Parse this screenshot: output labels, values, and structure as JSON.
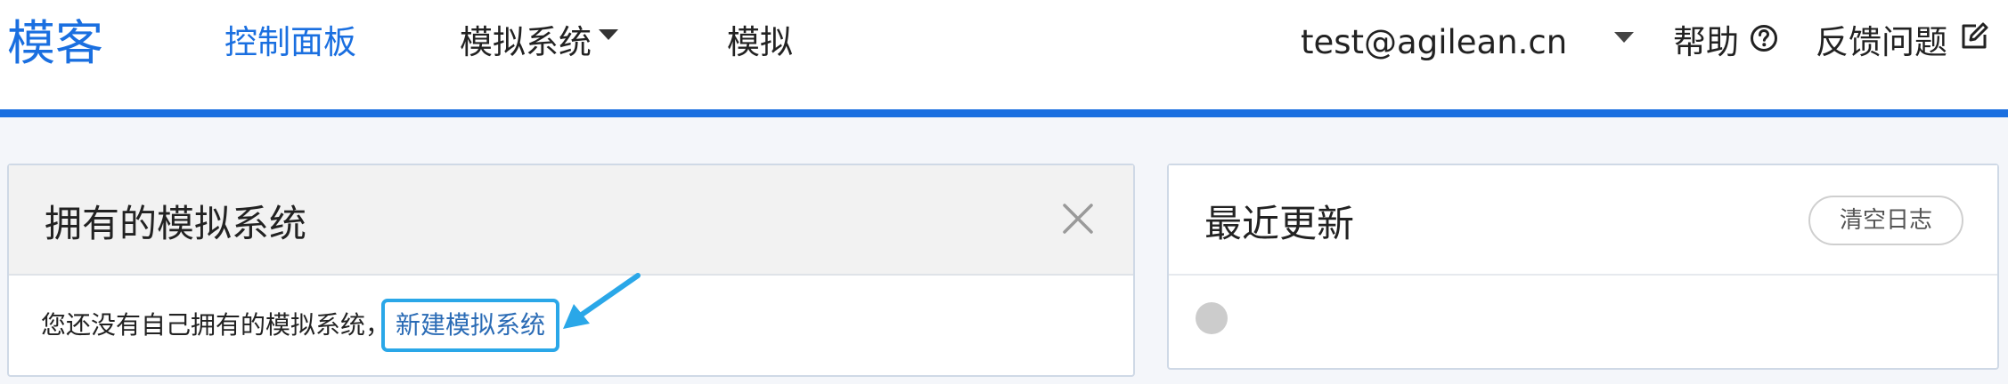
{
  "navbar": {
    "brand": "模客",
    "items": [
      {
        "label": "控制面板",
        "active": true
      },
      {
        "label": "模拟系统",
        "has_dropdown": true
      },
      {
        "label": "模拟"
      }
    ],
    "user_email": "test@agilean.cn",
    "help_label": "帮助",
    "feedback_label": "反馈问题"
  },
  "owned_panel": {
    "title": "拥有的模拟系统",
    "empty_text": "您还没有自己拥有的模拟系统，",
    "new_link": "新建模拟系统"
  },
  "updates_panel": {
    "title": "最近更新",
    "clear_button": "清空日志"
  },
  "colors": {
    "accent": "#1a6fe0",
    "link": "#2a6bb5",
    "annotation": "#2aa7e8"
  },
  "icons": [
    "caret-down-icon",
    "help-circle-icon",
    "edit-icon",
    "close-icon",
    "annotation-arrow-icon"
  ]
}
